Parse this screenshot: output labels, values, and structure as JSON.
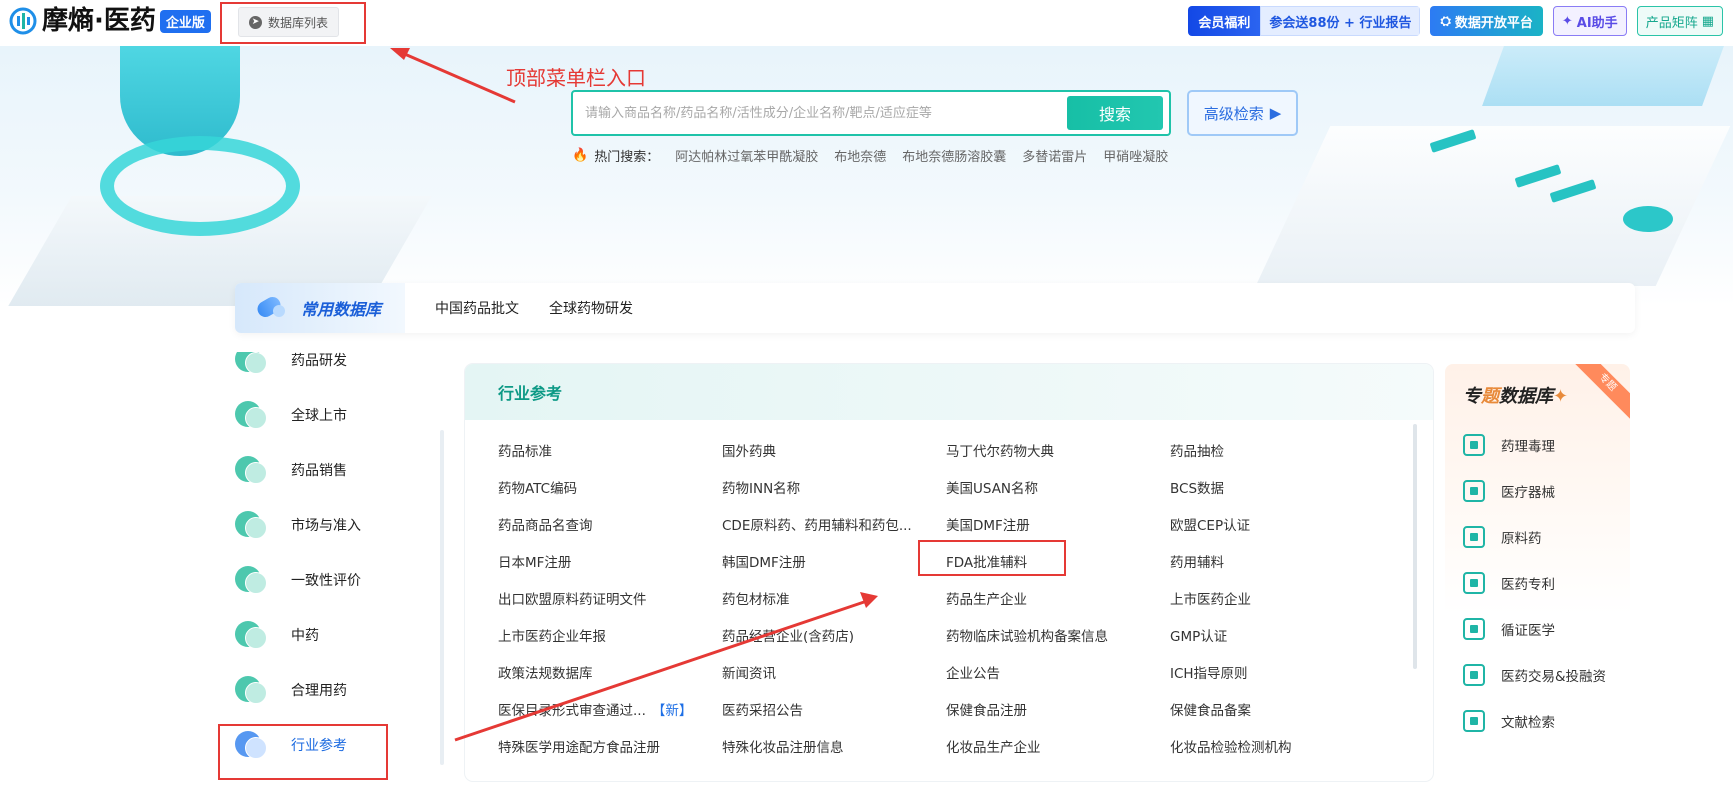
{
  "header": {
    "logo_text": "摩熵·医药",
    "edition_badge": "企业版",
    "db_list_button": "数据库列表",
    "member_tag": "会员福利",
    "member_offer": "参会送88份 + 行业报告",
    "open_platform": "数据开放平台",
    "ai_assistant": "AI助手",
    "product_matrix": "产品矩阵"
  },
  "annotation": {
    "top_menu_entry": "顶部菜单栏入口",
    "color": "#e53935"
  },
  "search": {
    "placeholder": "请输入商品名称/药品名称/活性成分/企业名称/靶点/适应症等",
    "button_label": "搜索",
    "advanced_label": "高级检索"
  },
  "hot_search": {
    "label": "热门搜索：",
    "items": [
      "阿达帕林过氧苯甲酰凝胶",
      "布地奈德",
      "布地奈德肠溶胶囊",
      "多替诺雷片",
      "甲硝唑凝胶"
    ]
  },
  "common_db": {
    "title": "常用数据库",
    "tabs": [
      "中国药品批文",
      "全球药物研发"
    ]
  },
  "sidenav": {
    "items": [
      {
        "label": "药品研发"
      },
      {
        "label": "全球上市"
      },
      {
        "label": "药品销售"
      },
      {
        "label": "市场与准入"
      },
      {
        "label": "一致性评价"
      },
      {
        "label": "中药"
      },
      {
        "label": "合理用药"
      },
      {
        "label": "行业参考"
      }
    ],
    "active": "行业参考"
  },
  "panel": {
    "title": "行业参考",
    "items": [
      "药品标准",
      "国外药典",
      "马丁代尔药物大典",
      "药品抽检",
      "药物ATC编码",
      "药物INN名称",
      "美国USAN名称",
      "BCS数据",
      "药品商品名查询",
      "CDE原料药、药用辅料和药包...",
      "美国DMF注册",
      "欧盟CEP认证",
      "日本MF注册",
      "韩国DMF注册",
      "FDA批准辅料",
      "药用辅料",
      "出口欧盟原料药证明文件",
      "药包材标准",
      "药品生产企业",
      "上市医药企业",
      "上市医药企业年报",
      "药品经营企业(含药店)",
      "药物临床试验机构备案信息",
      "GMP认证",
      "政策法规数据库",
      "新闻资讯",
      "企业公告",
      "ICH指导原则",
      "医保目录形式审查通过...",
      "医药采招公告",
      "保健食品注册",
      "保健食品备案",
      "特殊医学用途配方食品注册",
      "特殊化妆品注册信息",
      "化妆品生产企业",
      "化妆品检验检测机构"
    ],
    "new_tag": "【新】"
  },
  "special_db": {
    "title_pre": "专",
    "title_mid": "题",
    "title_post": "数据库",
    "ribbon": "专题",
    "items": [
      "药理毒理",
      "医疗器械",
      "原料药",
      "医药专利",
      "循证医学",
      "医药交易&投融资",
      "文献检索"
    ]
  },
  "colors": {
    "brand": "#1f6ff0",
    "accent": "#1fc3a9",
    "annotation": "#e53935"
  }
}
